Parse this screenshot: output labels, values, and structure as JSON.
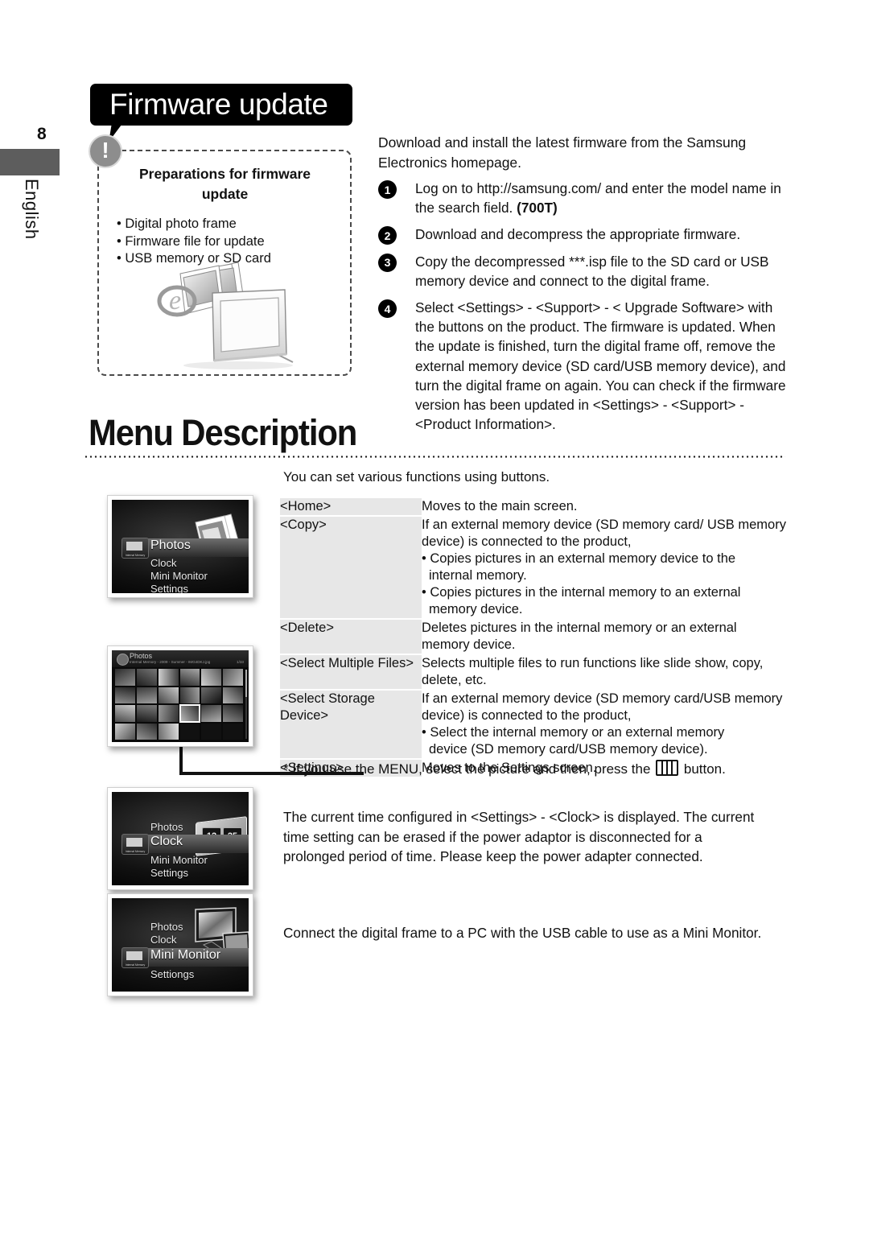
{
  "margin": {
    "page_number": "8",
    "language": "English"
  },
  "firmware": {
    "banner_title": "Firmware update",
    "warning_icon_glyph": "!",
    "prep_title_line1": "Preparations for firmware",
    "prep_title_line2": "update",
    "prep_items": [
      "• Digital photo frame",
      "• Firmware file for update",
      "• USB memory or SD card"
    ],
    "intro": "Download and install the latest firmware from the Samsung Electronics homepage.",
    "steps": [
      {
        "num": "1",
        "text_before": "Log on to http://samsung.com/ and enter the model name in the search field. ",
        "bold": "(700T)",
        "text_after": ""
      },
      {
        "num": "2",
        "text_before": "Download and decompress the appropriate firmware.",
        "bold": "",
        "text_after": ""
      },
      {
        "num": "3",
        "text_before": "Copy the decompressed ***.isp file to the SD card or USB memory device and connect to the digital frame.",
        "bold": "",
        "text_after": ""
      },
      {
        "num": "4",
        "text_before": "Select <Settings> - <Support> - < Upgrade Software> with the buttons on the product. The firmware is updated. When the update is finished, turn the digital frame off, remove the external memory device (SD card/USB memory device), and turn the digital frame on again. You can check if the firmware version has been updated in <Settings> - <Support> - <Product Information>.",
        "bold": "",
        "text_after": ""
      }
    ]
  },
  "menu_description": {
    "heading": "Menu Description",
    "intro": "You can set various functions using buttons.",
    "table": [
      {
        "key": "<Home>",
        "lines": [
          {
            "style": "plain",
            "text": "Moves to the main screen."
          }
        ]
      },
      {
        "key": "<Copy>",
        "lines": [
          {
            "style": "plain",
            "text": "If an external memory device (SD memory card/ USB memory device) is connected to the product,"
          },
          {
            "style": "bullet",
            "text": "• Copies pictures in an external memory device to the"
          },
          {
            "style": "sub",
            "text": "internal memory."
          },
          {
            "style": "bullet",
            "text": "• Copies pictures in the internal memory to an external"
          },
          {
            "style": "sub",
            "text": "memory device."
          }
        ]
      },
      {
        "key": "<Delete>",
        "lines": [
          {
            "style": "plain",
            "text": "Deletes pictures in the internal memory or an external memory device."
          }
        ]
      },
      {
        "key": "<Select Multiple Files>",
        "lines": [
          {
            "style": "plain",
            "text": "Selects multiple files to run functions like slide show, copy, delete, etc."
          }
        ]
      },
      {
        "key": "<Select Storage Device>",
        "lines": [
          {
            "style": "plain",
            "text": "If an external memory device (SD memory card/USB memory device) is connected to the product,"
          },
          {
            "style": "bullet",
            "text": "• Select the internal memory or an external memory"
          },
          {
            "style": "sub",
            "text": "device (SD memory card/USB memory device)."
          }
        ]
      },
      {
        "key": "<Settings>",
        "lines": [
          {
            "style": "plain",
            "text": "Moves to the Settings screen."
          }
        ]
      }
    ],
    "footnote_before": "* If you use the MENU, select the picture and then, press the ",
    "footnote_icon": "menu-button-icon",
    "footnote_after": " button.",
    "clock_paragraph": "The current time configured in <Settings> - <Clock> is displayed. The current time setting can be erased if the power adaptor is disconnected for a prolonged period of time. Please keep the power adapter connected.",
    "mini_monitor_paragraph": "Connect the digital frame to a PC with the USB cable to use as a Mini Monitor."
  },
  "screens": {
    "photos_menu": {
      "items": [
        "Photos",
        "Clock",
        "Mini Monitor",
        "Settings"
      ],
      "selected": "Photos",
      "badge_label": "Internal Memory"
    },
    "photo_grid": {
      "title": "Photos",
      "subtitle": "Internal Memory - 2009 - Summer - IMG4DKJ.jpg",
      "page_indicator": "1/33"
    },
    "clock_menu": {
      "items": [
        "Photos",
        "Clock",
        "Mini Monitor",
        "Settings"
      ],
      "selected": "Clock",
      "badge_label": "Internal Memory",
      "clock_hour": "12",
      "clock_minute": "25"
    },
    "mini_monitor_menu": {
      "items": [
        "Photos",
        "Clock",
        "Mini Monitor",
        "Settiongs"
      ],
      "selected": "Mini Monitor",
      "badge_label": "Internal Memory"
    }
  },
  "colors": {
    "banner_bg": "#000000",
    "tab_gray": "#5d5d5d",
    "table_key_bg": "#e7e7e7",
    "warn_circle": "#8d8d8d"
  }
}
